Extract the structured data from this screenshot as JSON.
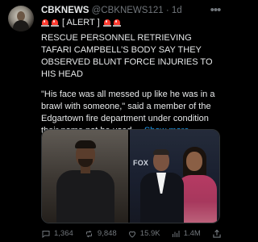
{
  "tweet": {
    "display_name": "CBKNEWS",
    "handle": "@CBKNEWS121",
    "separator": "·",
    "time": "1d",
    "alert_label": "[ ALERT ]",
    "paragraph1": "RESCUE PERSONNEL RETRIEVING TAFARI CAMPBELL’S BODY SAY THEY OBSERVED BLUNT FORCE INJURIES TO HIS HEAD",
    "paragraph2": "\"His face was all messed up like he was in a brawl with someone,\" said a member of the Edgartown fire department under condition their name not be used....",
    "show_more": "Show more",
    "media_text": "FOX",
    "actions": {
      "reply_count": "1,364",
      "repost_count": "9,848",
      "like_count": "15.9K",
      "view_count": "1.4M"
    },
    "icons": {
      "more": "more-icon",
      "siren": "siren-icon",
      "reply": "reply-icon",
      "repost": "repost-icon",
      "like": "like-icon",
      "views": "views-icon",
      "share": "share-icon"
    },
    "colors": {
      "background": "#000000",
      "primary_text": "#e7e9ea",
      "secondary_text": "#71767b",
      "link": "#1d9bf0"
    }
  }
}
